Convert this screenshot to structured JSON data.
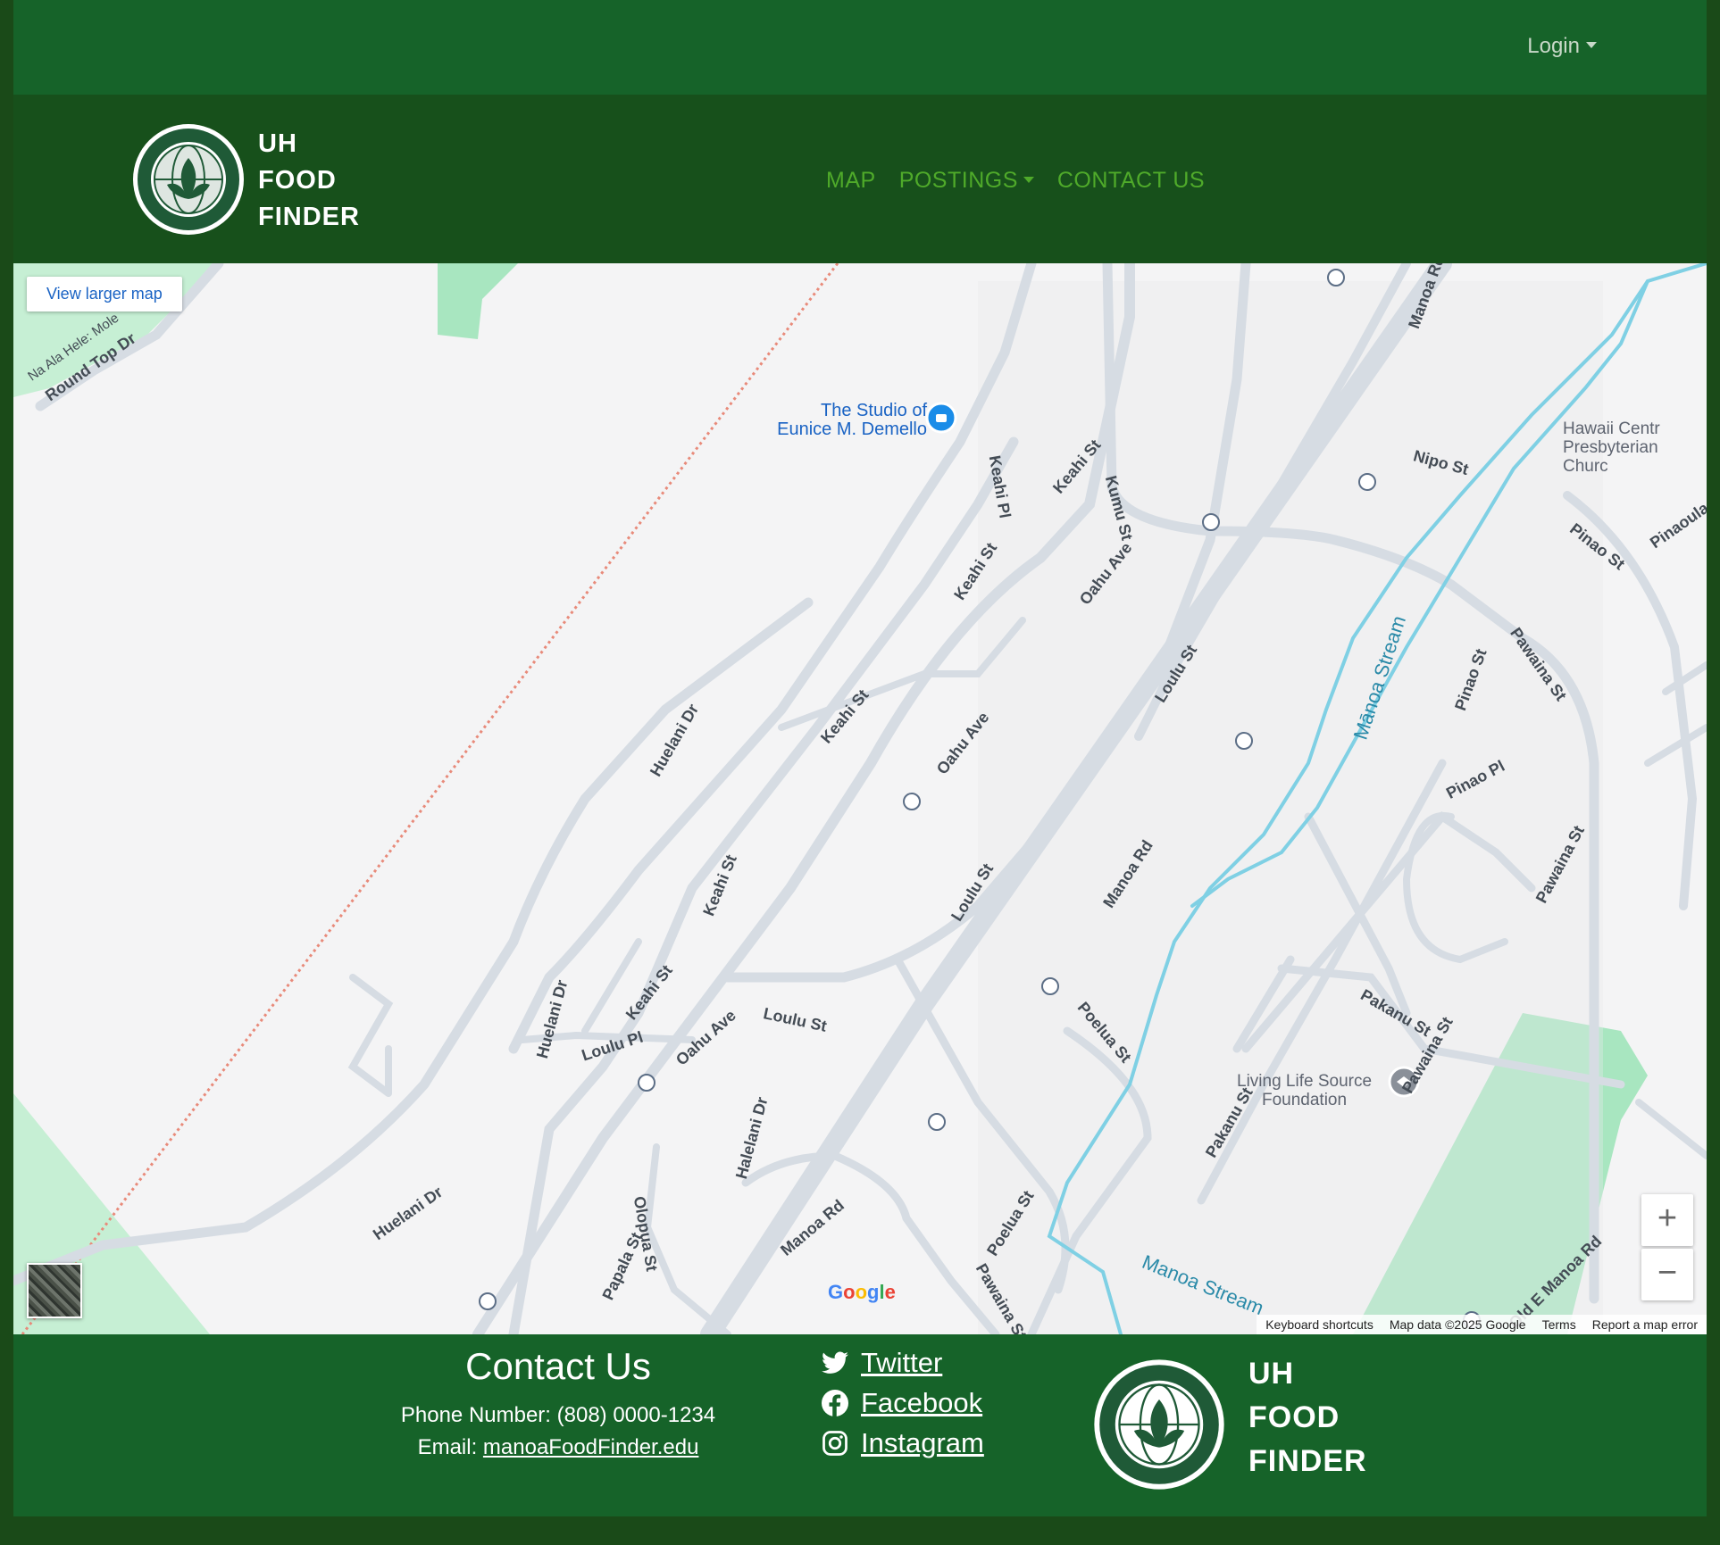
{
  "topbar": {
    "login_label": "Login"
  },
  "brand": {
    "line1": "UH",
    "line2": "FOOD",
    "line3": "FINDER"
  },
  "nav": {
    "map": "MAP",
    "postings": "POSTINGS",
    "contact": "CONTACT US"
  },
  "map": {
    "view_larger": "View larger map",
    "poi_studio_line1": "The Studio of",
    "poi_studio_line2": "Eunice M. Demello",
    "poi_hawaii_line1": "Hawaii Centr",
    "poi_hawaii_line2": "Presbyterian Churc",
    "poi_living_line1": "Living Life Source",
    "poi_living_line2": "Foundation",
    "streets": {
      "round_top": "Round Top Dr",
      "na_ala": "Na Ala Hele: Mole",
      "keahi_pl": "Keahi Pl",
      "keahi_1": "Keahi St",
      "keahi_2": "Keahi St",
      "keahi_3": "Keahi St",
      "keahi_4": "Keahi St",
      "keahi_5": "Keahi St",
      "kumu": "Kumu St",
      "oahu_1": "Oahu Ave",
      "oahu_2": "Oahu Ave",
      "oahu_3": "Oahu Ave",
      "loulu_1": "Loulu St",
      "loulu_2": "Loulu St",
      "loulu_3": "Loulu St",
      "loulu_pl": "Loulu Pl",
      "manoa_1": "Manoa Rd",
      "manoa_2": "Manoa Rd",
      "manoa_3": "Manoa Rd",
      "nipo": "Nipo St",
      "pinao_1": "Pinao St",
      "pinao_2": "Pinao St",
      "pinao_pl": "Pinao Pl",
      "pinaoula": "Pinaoula St",
      "pawaina_1": "Pawaina St",
      "pawaina_2": "Pawaina St",
      "pawaina_3": "Pawaina St",
      "pawaina_4": "Pawaina St",
      "manoa_stream_1": "Mānoa Stream",
      "manoa_stream_2": "Manoa Stream",
      "huelani_1": "Huelani Dr",
      "huelani_2": "Huelani Dr",
      "huelani_3": "Huelani Dr",
      "halelani": "Halelani Dr",
      "olopua": "Olopua St",
      "papala": "Papala St",
      "poelua_1": "Poelua St",
      "poelua_2": "Poelua St",
      "pakanu_1": "Pakanu St",
      "pakanu_2": "Pakanu St",
      "old_manoa": "Old E Manoa Rd"
    },
    "zoom_in": "+",
    "zoom_out": "−",
    "google_logo": "Google",
    "attrib_keyboard": "Keyboard shortcuts",
    "attrib_data": "Map data ©2025 Google",
    "attrib_terms": "Terms",
    "attrib_report": "Report a map error"
  },
  "footer": {
    "title": "Contact Us",
    "phone_label": "Phone Number: (808) 0000-1234",
    "email_label": "Email: ",
    "email": "manoaFoodFinder.edu",
    "twitter": "Twitter",
    "facebook": "Facebook",
    "instagram": "Instagram"
  },
  "colors": {
    "topbar": "#166329",
    "navbar": "#17501b",
    "nav_link": "#4faa2a",
    "footer": "#166329",
    "map_bg": "#f4f4f5",
    "road": "#d6dce3",
    "stream": "#7fd0e4",
    "park": "#a8e6c0"
  }
}
